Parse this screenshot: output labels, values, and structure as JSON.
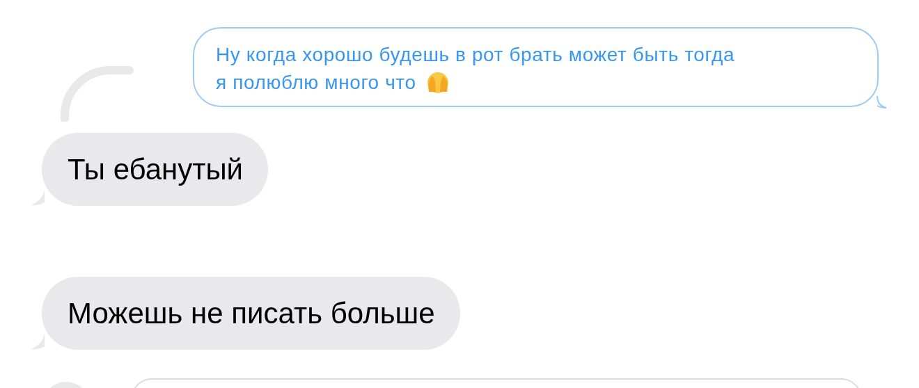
{
  "quoted_message": {
    "lines": [
      "Ну когда хорошо будешь в рот брать может быть тогда",
      "я полюблю много что"
    ]
  },
  "messages": [
    {
      "text": "Ты ебанутый"
    },
    {
      "text": "Можешь не писать больше"
    }
  ]
}
